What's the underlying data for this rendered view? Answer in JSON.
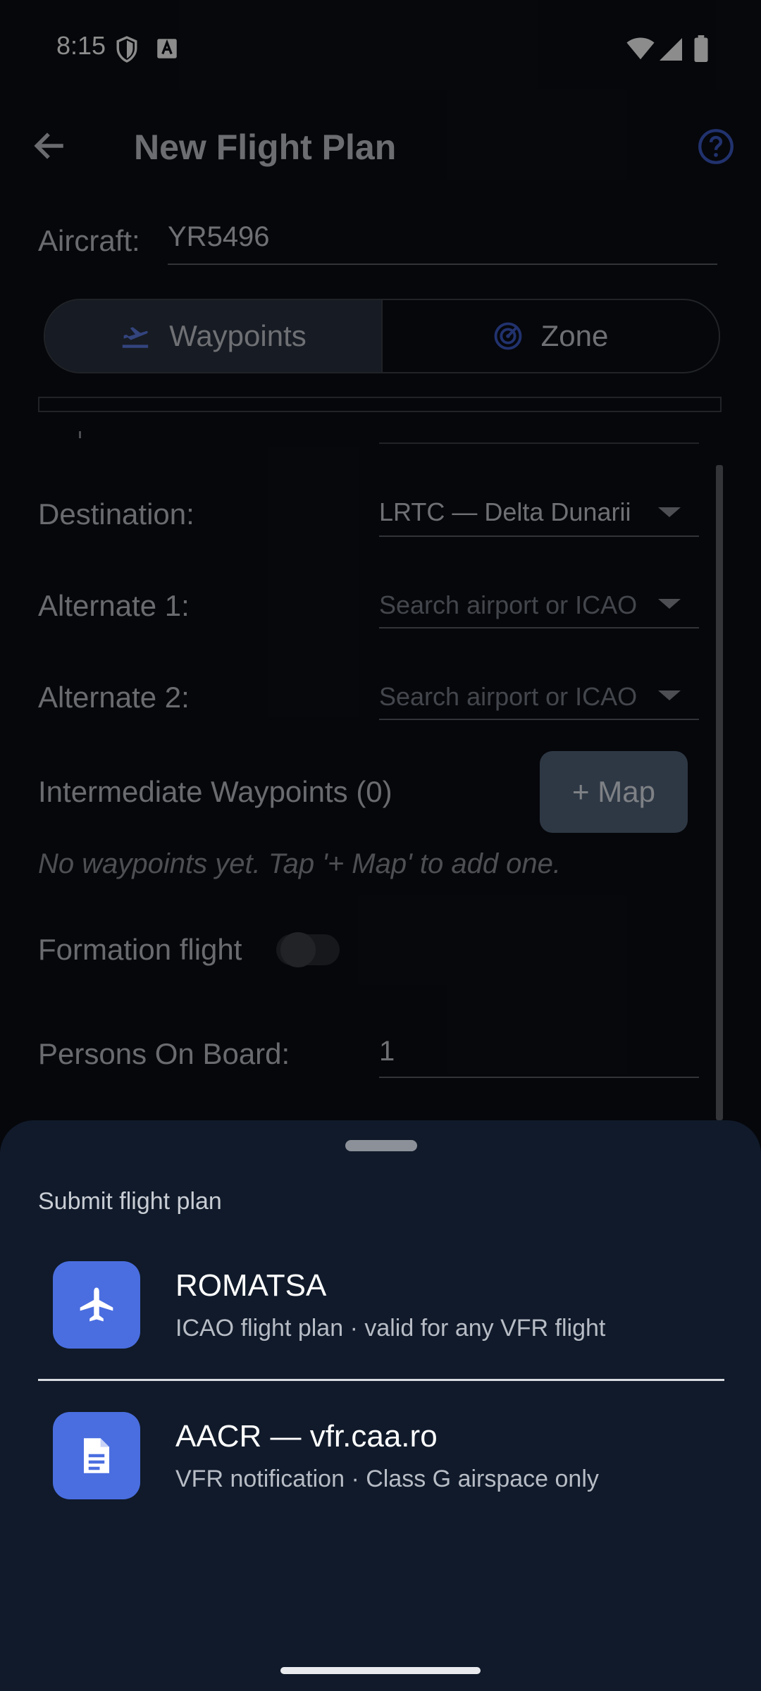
{
  "status_bar": {
    "time": "8:15"
  },
  "app_bar": {
    "title": "New Flight Plan"
  },
  "aircraft": {
    "label": "Aircraft:",
    "value": "YR5496"
  },
  "mode_tabs": [
    {
      "label": "Waypoints",
      "selected": true
    },
    {
      "label": "Zone",
      "selected": false
    }
  ],
  "form": {
    "destination_label": "Destination:",
    "destination_value": "LRTC — Delta Dunarii",
    "alternate1_label": "Alternate 1:",
    "alternate1_placeholder": "Search airport or ICAO",
    "alternate2_label": "Alternate 2:",
    "alternate2_placeholder": "Search airport or ICAO",
    "waypoints_label": "Intermediate Waypoints (0)",
    "map_button": "+ Map",
    "waypoints_empty": "No waypoints yet. Tap '+ Map' to add one.",
    "formation_label": "Formation flight",
    "formation_on": false,
    "pob_label": "Persons On Board:",
    "pob_value": "1"
  },
  "sheet": {
    "title": "Submit flight plan",
    "options": [
      {
        "title": "ROMATSA",
        "subtitle": "ICAO flight plan · valid for any VFR flight",
        "icon": "airplane-icon"
      },
      {
        "title": "AACR — vfr.caa.ro",
        "subtitle": "VFR notification · Class G airspace only",
        "icon": "document-icon"
      }
    ]
  },
  "colors": {
    "accent": "#4a6ee0",
    "sheet_bg": "#101a2a",
    "page_bg": "#0b0e14"
  }
}
